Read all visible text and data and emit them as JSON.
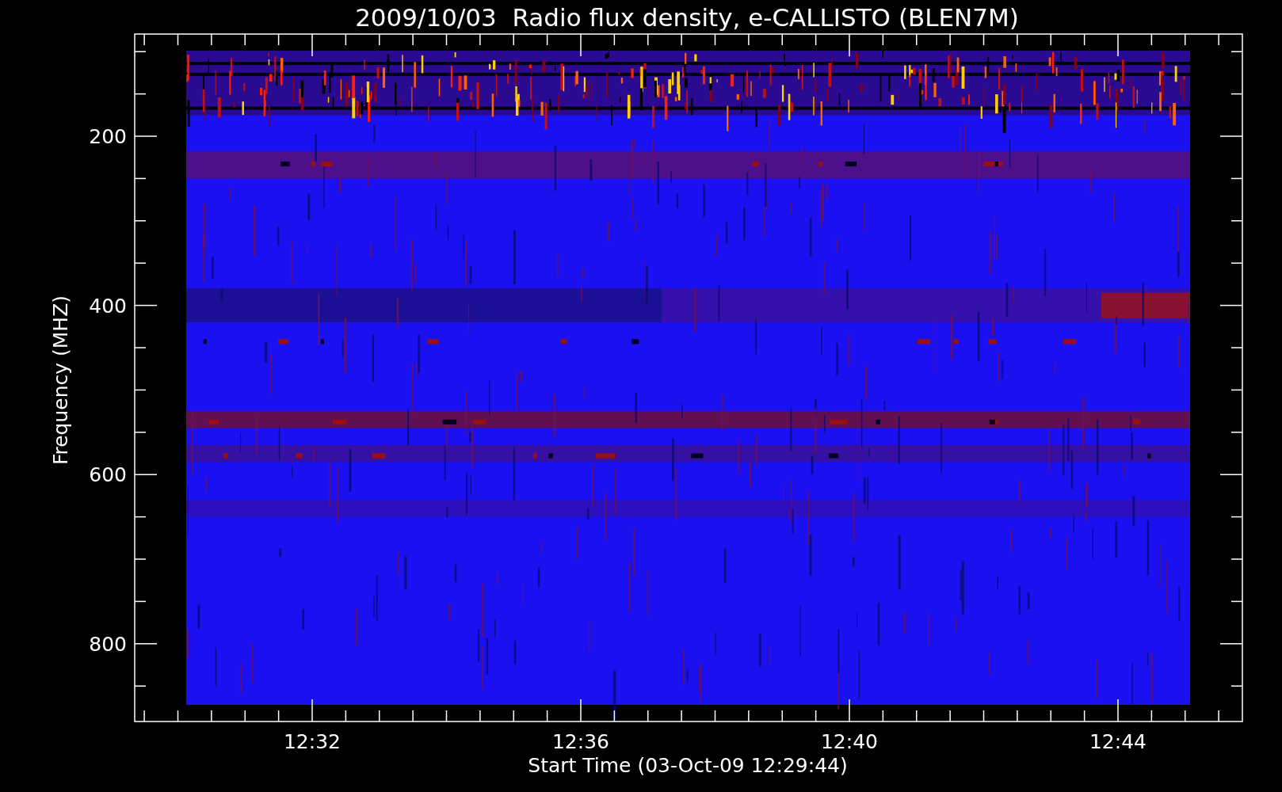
{
  "title": "2009/10/03  Radio flux density, e-CALLISTO (BLEN7M)",
  "y_axis": {
    "label": "Frequency (MHZ)",
    "ticks": [
      "200",
      "400",
      "600",
      "800"
    ]
  },
  "x_axis": {
    "label": "Start Time (03-Oct-09 12:29:44)",
    "ticks": [
      "12:32",
      "12:36",
      "12:40",
      "12:44"
    ]
  }
}
